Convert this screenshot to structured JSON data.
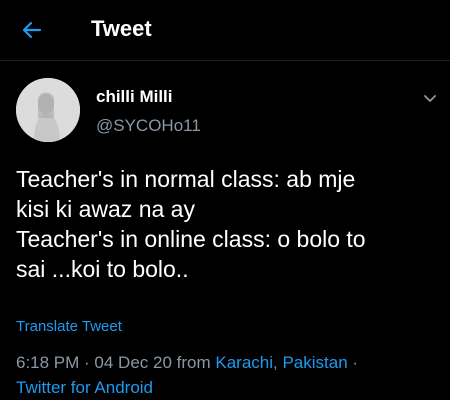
{
  "header": {
    "title": "Tweet",
    "back_icon": "arrow-left-icon",
    "accent_color": "#1d9bf0"
  },
  "author": {
    "display_name": "chilli Milli",
    "handle": "@SYCOHo11",
    "avatar_icon": "profile-photo"
  },
  "tweet": {
    "lines": [
      "Teacher's in normal class: ab mje",
      "kisi ki awaz na ay",
      "Teacher's in online class: o bolo to",
      "sai ...koi to bolo.."
    ]
  },
  "translate_label": "Translate Tweet",
  "meta": {
    "time_date": "6:18 PM · 04 Dec 20 from ",
    "location": "Karachi, Pakistan",
    "separator": " ·",
    "client": "Twitter for Android"
  },
  "menu_icon": "chevron-down-icon"
}
